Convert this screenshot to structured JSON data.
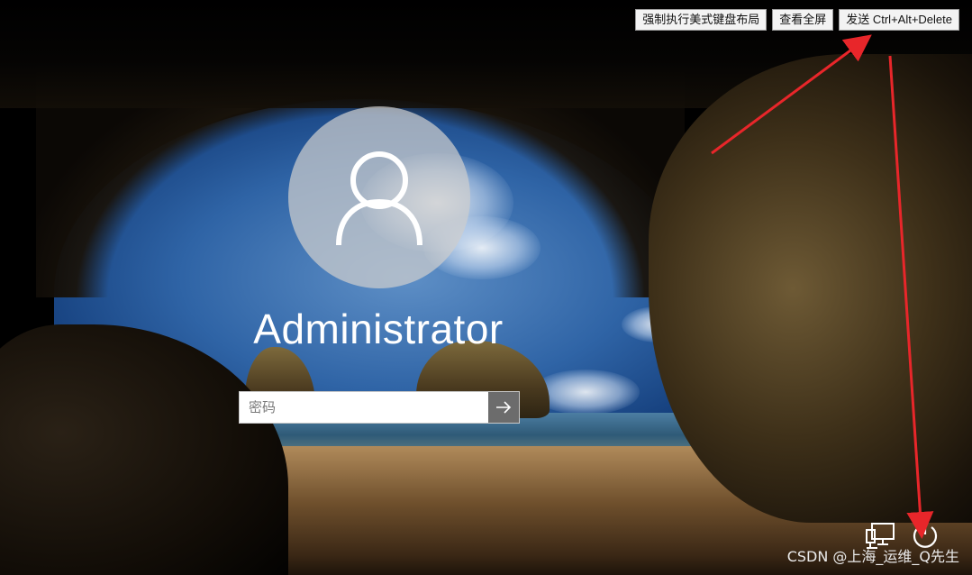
{
  "toolbar": {
    "force_us_keyboard": "强制执行美式键盘布局",
    "view_fullscreen": "查看全屏",
    "send_cad": "发送 Ctrl+Alt+Delete"
  },
  "login": {
    "username": "Administrator",
    "password_placeholder": "密码",
    "password_value": ""
  },
  "icons": {
    "avatar": "user-avatar-icon",
    "submit": "arrow-right-icon",
    "network": "network-icon",
    "power": "power-icon"
  },
  "watermark": "CSDN @上海_运维_Q先生",
  "colors": {
    "annotation_arrow": "#e8262a",
    "button_bg": "#f3f3f3",
    "submit_bg": "#6c6c6c"
  }
}
